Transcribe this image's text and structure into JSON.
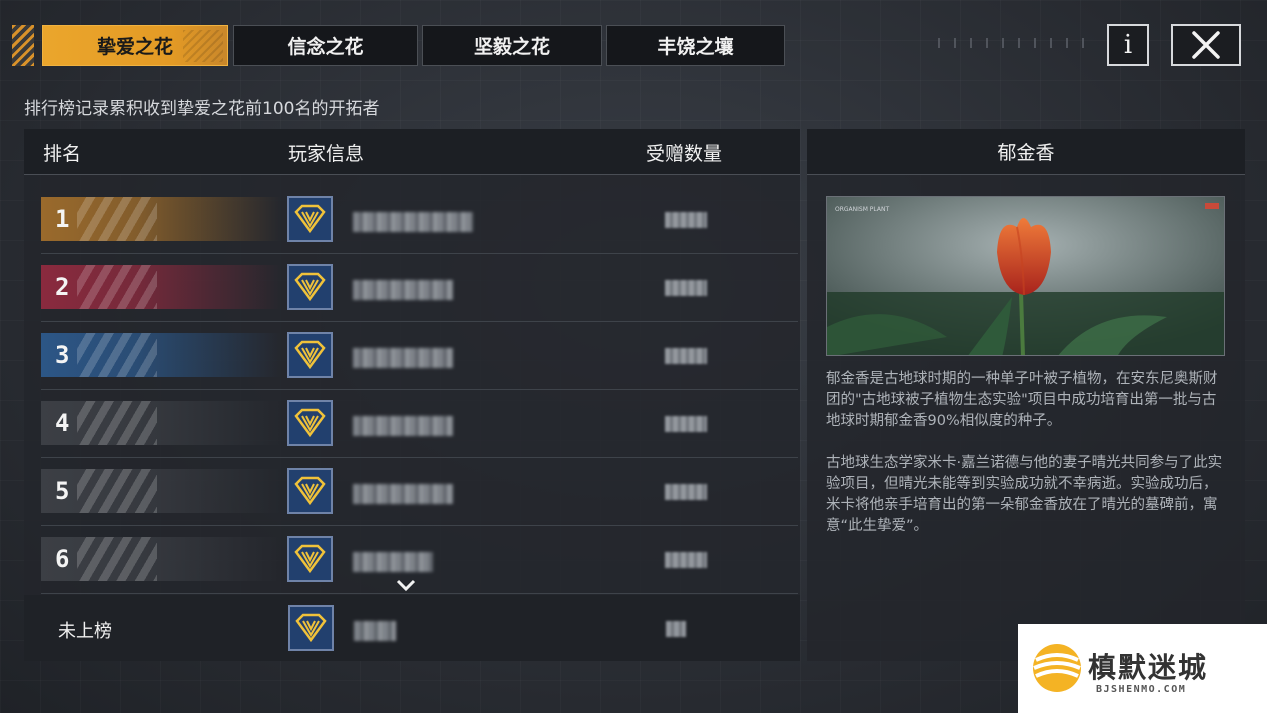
{
  "tabs": [
    {
      "label": "挚爱之花",
      "active": true
    },
    {
      "label": "信念之花",
      "active": false
    },
    {
      "label": "坚毅之花",
      "active": false
    },
    {
      "label": "丰饶之壤",
      "active": false
    }
  ],
  "toolbar": {
    "info_label": "i",
    "close_icon": "close-icon"
  },
  "subtitle": "排行榜记录累积收到挚爱之花前100名的开拓者",
  "ranking": {
    "headers": {
      "rank": "排名",
      "player": "玩家信息",
      "count": "受赠数量"
    },
    "rows": [
      {
        "rank": "1",
        "color": "#9a6a2c"
      },
      {
        "rank": "2",
        "color": "#8a2a3e"
      },
      {
        "rank": "3",
        "color": "#2c5686"
      },
      {
        "rank": "4",
        "color": "#3c3f45"
      },
      {
        "rank": "5",
        "color": "#3c3f45"
      },
      {
        "rank": "6",
        "color": "#3c3f45"
      }
    ],
    "unranked_label": "未上榜",
    "more_icon": "chevron-down-icon"
  },
  "detail": {
    "title": "郁金香",
    "paragraph1": "郁金香是古地球时期的一种单子叶被子植物，在安东尼奥斯财团的\"古地球被子植物生态实验\"项目中成功培育出第一批与古地球时期郁金香90%相似度的种子。",
    "paragraph2": "古地球生态学家米卡·嘉兰诺德与他的妻子晴光共同参与了此实验项目，但晴光未能等到实验成功就不幸病逝。实验成功后，米卡将他亲手培育出的第一朵郁金香放在了晴光的墓碑前，寓意“此生挚爱”。"
  },
  "watermark": {
    "title": "槙默迷城",
    "subtitle": "BJSHENMO.COM"
  }
}
